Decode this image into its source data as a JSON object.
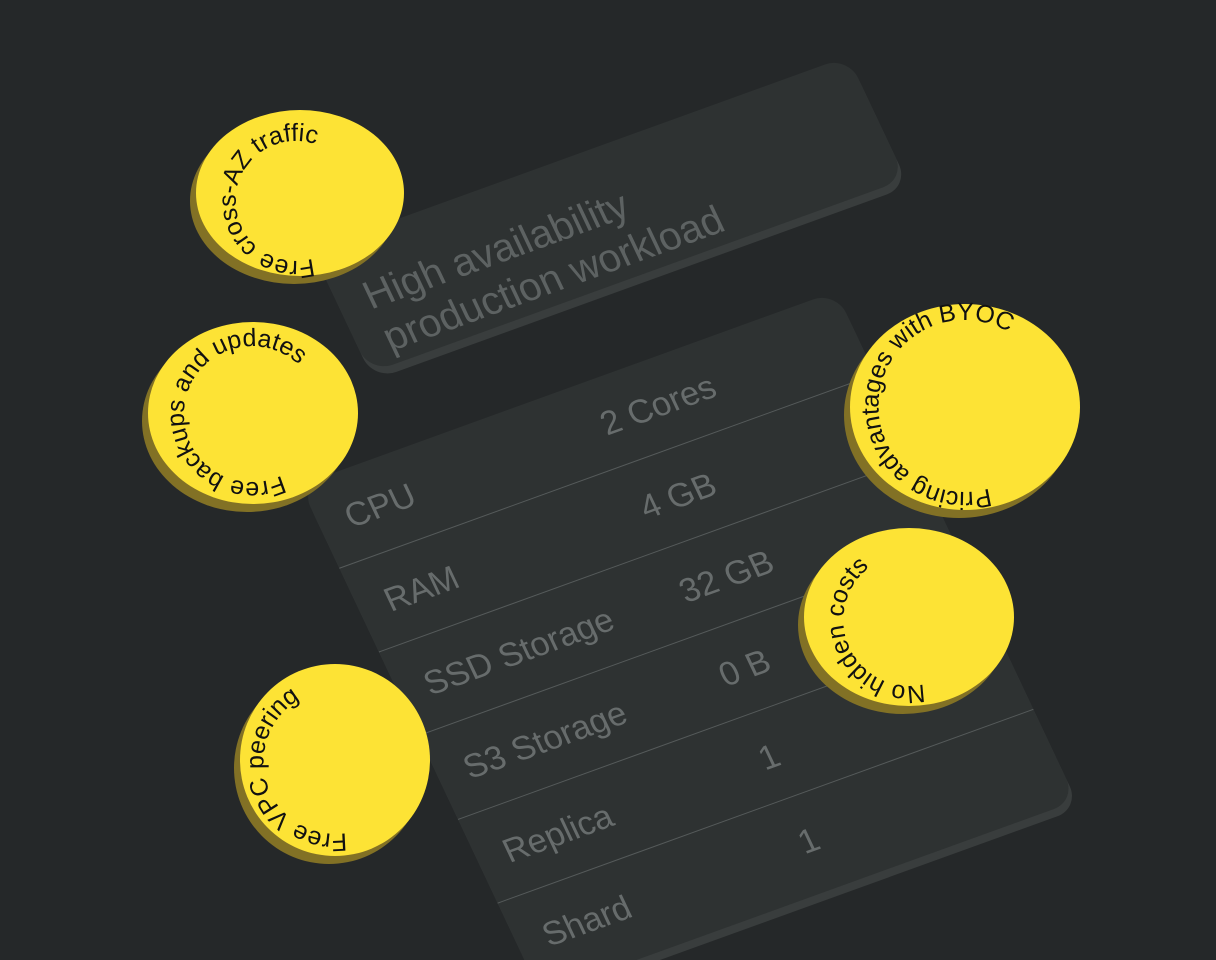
{
  "card": {
    "title": "High availability\nproduction workload",
    "rows": [
      {
        "label": "CPU",
        "value": "2 Cores"
      },
      {
        "label": "RAM",
        "value": "4 GB"
      },
      {
        "label": "SSD Storage",
        "value": "32 GB"
      },
      {
        "label": "S3 Storage",
        "value": "0 B"
      },
      {
        "label": "Replica",
        "value": "1"
      },
      {
        "label": "Shard",
        "value": "1"
      }
    ]
  },
  "coins": {
    "cross_az": "Free cross-AZ traffic",
    "backups": "Free backups and updates",
    "vpc": "Free VPC peering",
    "byoc": "Pricing advantages with BYOC",
    "hidden_costs": "No hidden costs"
  },
  "colors": {
    "background": "#252829",
    "card": "#2e3232",
    "coin": "#fde335",
    "coin_edge": "#827125"
  }
}
